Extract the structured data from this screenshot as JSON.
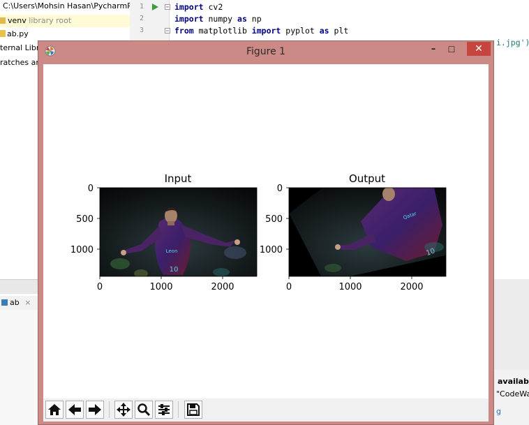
{
  "ide": {
    "project_path": "C:\\Users\\Mohsin Hasan\\PycharmP",
    "tree": [
      {
        "label": "venv",
        "note": "library root"
      },
      {
        "label": "ab.py",
        "note": ""
      },
      {
        "label": "ternal Libra",
        "note": ""
      },
      {
        "label": "ratches and",
        "note": ""
      }
    ],
    "code_lines": [
      {
        "num": "1",
        "kw1": "import",
        "rest": " cv2"
      },
      {
        "num": "2",
        "kw1": "import",
        "rest": " numpy ",
        "kw2": "as",
        "rest2": " np"
      },
      {
        "num": "3",
        "kw1": "from",
        "rest": " matplotlib ",
        "kw2": "import",
        "rest2": " pyplot ",
        "kw3": "as",
        "rest3": " plt"
      }
    ],
    "code_line4_tail": "i.jpg')",
    "run_tab_label": "ab",
    "run_tab_close": "×",
    "notification": {
      "title": "available",
      "line": "\"CodeWa",
      "link": "g"
    }
  },
  "figure": {
    "window_title": "Figure 1",
    "minimize_glyph": "–",
    "maximize_glyph": "☐",
    "close_glyph": "✕",
    "subplots": [
      {
        "title": "Input",
        "yticks": [
          "0",
          "500",
          "1000"
        ],
        "xticks": [
          "0",
          "1000",
          "2000"
        ]
      },
      {
        "title": "Output",
        "yticks": [
          "0",
          "500",
          "1000"
        ],
        "xticks": [
          "0",
          "1000",
          "2000"
        ]
      }
    ],
    "image_text": {
      "jersey_name": "Leon",
      "jersey_number": "10",
      "sponsor": "Qatar"
    }
  },
  "toolbar": {
    "buttons": [
      "home-icon",
      "back-arrow-icon",
      "forward-arrow-icon",
      "pan-icon",
      "zoom-icon",
      "configure-subplots-icon",
      "save-icon"
    ]
  }
}
